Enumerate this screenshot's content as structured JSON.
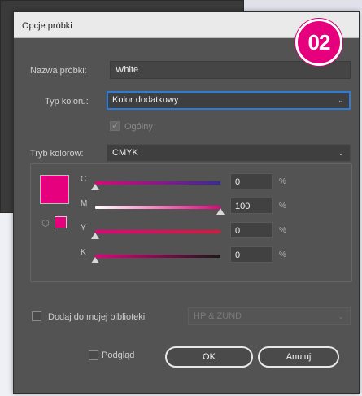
{
  "dialog": {
    "title": "Opcje próbki",
    "badge": "02"
  },
  "form": {
    "swatch_name_label": "Nazwa próbki:",
    "swatch_name_value": "White",
    "color_type_label": "Typ koloru:",
    "color_type_value": "Kolor dodatkowy",
    "global_label": "Ogólny",
    "global_checked": true,
    "color_mode_label": "Tryb kolorów:",
    "color_mode_value": "CMYK"
  },
  "color": {
    "swatch_color": "#e6007e",
    "channels": [
      {
        "label": "C",
        "value": "0",
        "unit": "%",
        "level": 0,
        "gradient": [
          "#e6007e",
          "#3a2a9a"
        ]
      },
      {
        "label": "M",
        "value": "100",
        "unit": "%",
        "level": 1,
        "gradient": [
          "#ffffff",
          "#e6007e"
        ]
      },
      {
        "label": "Y",
        "value": "0",
        "unit": "%",
        "level": 0,
        "gradient": [
          "#e6007e",
          "#d51a3a"
        ]
      },
      {
        "label": "K",
        "value": "0",
        "unit": "%",
        "level": 0,
        "gradient": [
          "#e6007e",
          "#1a1a1a"
        ]
      }
    ]
  },
  "library": {
    "add_label": "Dodaj do mojej biblioteki",
    "library_value": "HP & ZUND"
  },
  "footer": {
    "preview_label": "Podgląd",
    "ok_label": "OK",
    "cancel_label": "Anuluj"
  }
}
